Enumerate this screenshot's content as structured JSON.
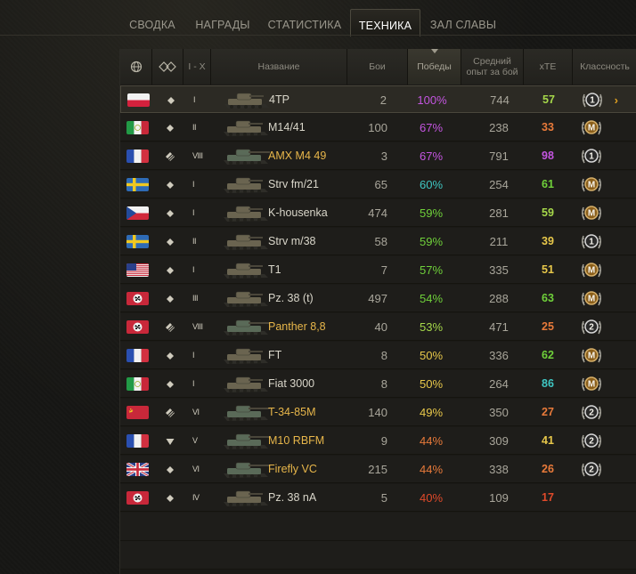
{
  "tabs": [
    {
      "label": "СВОДКА",
      "active": false
    },
    {
      "label": "НАГРАДЫ",
      "active": false
    },
    {
      "label": "СТАТИСТИКА",
      "active": false
    },
    {
      "label": "ТЕХНИКА",
      "active": true
    },
    {
      "label": "ЗАЛ СЛАВЫ",
      "active": false
    }
  ],
  "columns": {
    "nation_icon": "globe-icon",
    "type_icon": "vehicle-type-icon",
    "tier": "I - X",
    "name": "Название",
    "battles": "Бои",
    "wins": "Победы",
    "avg_xp": "Средний опыт за бой",
    "xte": "xTE",
    "mastery": "Классность"
  },
  "colors": {
    "gold": "#e7b64a",
    "purple": "#c455e0",
    "teal": "#3fc6c2",
    "green": "#6fd03a",
    "lime": "#a6d84a",
    "yellow": "#e8c84a",
    "orange": "#e87a3a",
    "red": "#e04a2a"
  },
  "vehicles": [
    {
      "flag": "poland",
      "type": "light",
      "tier": "I",
      "name": "4TP",
      "premium": false,
      "battles": "2",
      "wins": "100%",
      "wins_color": "#c455e0",
      "xp": "744",
      "xte": "57",
      "xte_color": "#a6d84a",
      "mastery": "1",
      "selected": true
    },
    {
      "flag": "italy",
      "type": "light",
      "tier": "II",
      "name": "M14/41",
      "premium": false,
      "battles": "100",
      "wins": "67%",
      "wins_color": "#c455e0",
      "xp": "238",
      "xte": "33",
      "xte_color": "#e87a3a",
      "mastery": "M"
    },
    {
      "flag": "france",
      "type": "medium",
      "tier": "VIII",
      "name": "AMX M4 49",
      "premium": true,
      "battles": "3",
      "wins": "67%",
      "wins_color": "#c455e0",
      "xp": "791",
      "xte": "98",
      "xte_color": "#c455e0",
      "mastery": "1"
    },
    {
      "flag": "sweden",
      "type": "light",
      "tier": "I",
      "name": "Strv fm/21",
      "premium": false,
      "battles": "65",
      "wins": "60%",
      "wins_color": "#3fc6c2",
      "xp": "254",
      "xte": "61",
      "xte_color": "#6fd03a",
      "mastery": "M"
    },
    {
      "flag": "czech",
      "type": "light",
      "tier": "I",
      "name": "K-housenka",
      "premium": false,
      "battles": "474",
      "wins": "59%",
      "wins_color": "#6fd03a",
      "xp": "281",
      "xte": "59",
      "xte_color": "#a6d84a",
      "mastery": "M"
    },
    {
      "flag": "sweden",
      "type": "light",
      "tier": "II",
      "name": "Strv m/38",
      "premium": false,
      "battles": "58",
      "wins": "59%",
      "wins_color": "#6fd03a",
      "xp": "211",
      "xte": "39",
      "xte_color": "#e8c84a",
      "mastery": "1"
    },
    {
      "flag": "usa",
      "type": "light",
      "tier": "I",
      "name": "T1",
      "premium": false,
      "battles": "7",
      "wins": "57%",
      "wins_color": "#6fd03a",
      "xp": "335",
      "xte": "51",
      "xte_color": "#e8c84a",
      "mastery": "M"
    },
    {
      "flag": "germany",
      "type": "light",
      "tier": "III",
      "name": "Pz. 38 (t)",
      "premium": false,
      "battles": "497",
      "wins": "54%",
      "wins_color": "#6fd03a",
      "xp": "288",
      "xte": "63",
      "xte_color": "#6fd03a",
      "mastery": "M"
    },
    {
      "flag": "germany",
      "type": "medium",
      "tier": "VIII",
      "name": "Panther 8,8",
      "premium": true,
      "battles": "40",
      "wins": "53%",
      "wins_color": "#a6d84a",
      "xp": "471",
      "xte": "25",
      "xte_color": "#e87a3a",
      "mastery": "2"
    },
    {
      "flag": "france",
      "type": "light",
      "tier": "I",
      "name": "FT",
      "premium": false,
      "battles": "8",
      "wins": "50%",
      "wins_color": "#e8c84a",
      "xp": "336",
      "xte": "62",
      "xte_color": "#6fd03a",
      "mastery": "M"
    },
    {
      "flag": "italy",
      "type": "light",
      "tier": "I",
      "name": "Fiat 3000",
      "premium": false,
      "battles": "8",
      "wins": "50%",
      "wins_color": "#e8c84a",
      "xp": "264",
      "xte": "86",
      "xte_color": "#3fc6c2",
      "mastery": "M"
    },
    {
      "flag": "ussr",
      "type": "medium",
      "tier": "VI",
      "name": "T-34-85M",
      "premium": true,
      "battles": "140",
      "wins": "49%",
      "wins_color": "#e8c84a",
      "xp": "350",
      "xte": "27",
      "xte_color": "#e87a3a",
      "mastery": "2"
    },
    {
      "flag": "france",
      "type": "td",
      "tier": "V",
      "name": "M10 RBFM",
      "premium": true,
      "battles": "9",
      "wins": "44%",
      "wins_color": "#e87a3a",
      "xp": "309",
      "xte": "41",
      "xte_color": "#e8c84a",
      "mastery": "2"
    },
    {
      "flag": "uk",
      "type": "light",
      "tier": "VI",
      "name": "Firefly VC",
      "premium": true,
      "battles": "215",
      "wins": "44%",
      "wins_color": "#e87a3a",
      "xp": "338",
      "xte": "26",
      "xte_color": "#e87a3a",
      "mastery": "2"
    },
    {
      "flag": "germany",
      "type": "light",
      "tier": "IV",
      "name": "Pz. 38 nA",
      "premium": false,
      "battles": "5",
      "wins": "40%",
      "wins_color": "#e04a2a",
      "xp": "109",
      "xte": "17",
      "xte_color": "#e04a2a",
      "mastery": ""
    }
  ]
}
